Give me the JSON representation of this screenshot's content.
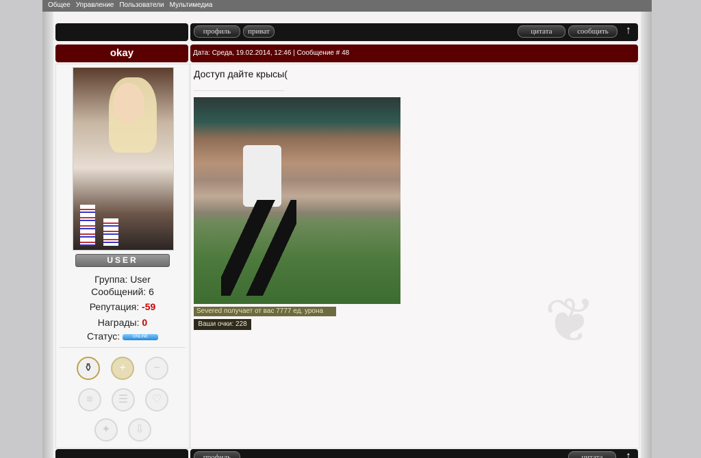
{
  "topnav": [
    "Общее",
    "Управление",
    "Пользователи",
    "Мультимедиа"
  ],
  "actions": {
    "profile": "профиль",
    "private": "приват",
    "quote": "цитата",
    "report": "сообщить",
    "up": "↑"
  },
  "post": {
    "username": "okay",
    "meta": "Дата: Среда, 19.02.2014, 12:46 | Сообщение # 48",
    "text": "Доступ дайте крысы(",
    "banner_damage": "Severed получает от вас 7777 ед. урона",
    "banner_points": "Ваши очки: 228"
  },
  "user": {
    "badge": "USER",
    "group_label": "Группа:",
    "group_value": "User",
    "messages_label": "Сообщений:",
    "messages_value": "6",
    "rep_label": "Репутация:",
    "rep_value": "-59",
    "awards_label": "Награды:",
    "awards_value": "0",
    "status_label": "Статус:",
    "status_value": "ONLINE"
  },
  "colors": {
    "header_red": "#5a0000",
    "dark_bar": "#141414",
    "negative": "#cc0000",
    "online": "#2a88d8"
  }
}
